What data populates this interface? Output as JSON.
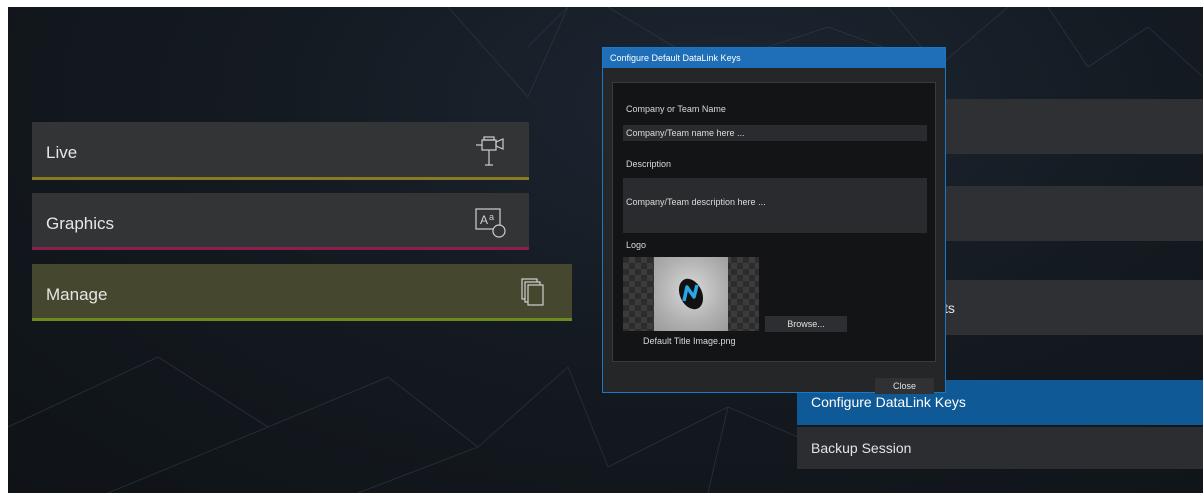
{
  "main_menu": {
    "items": [
      {
        "label": "Live",
        "icon": "camera-icon"
      },
      {
        "label": "Graphics",
        "icon": "graphics-icon"
      },
      {
        "label": "Manage",
        "icon": "documents-icon"
      }
    ]
  },
  "right_menu": {
    "partial_item_text": "cts",
    "configure_label": "Configure DataLink Keys",
    "backup_label": "Backup Session"
  },
  "dialog": {
    "title": "Configure Default DataLink Keys",
    "company_label": "Company or Team Name",
    "company_value": "Company/Team name here ...",
    "description_label": "Description",
    "description_value": "Company/Team description here ...",
    "logo_label": "Logo",
    "logo_filename": "Default Title Image.png",
    "browse_label": "Browse...",
    "close_label": "Close"
  },
  "colors": {
    "accent_blue": "#1f6fb8",
    "live_underline": "#8a7a22",
    "graphics_underline": "#8a1f4e",
    "manage_underline": "#6d8a1f"
  }
}
